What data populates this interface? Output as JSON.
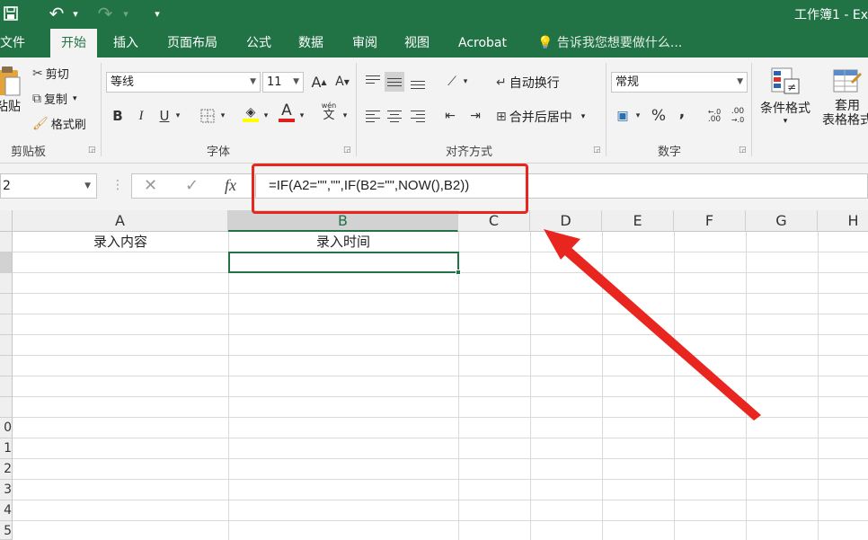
{
  "titlebar": {
    "doc_title": "工作簿1 - Ex",
    "undo_glyph": "↶",
    "redo_glyph": "↷",
    "customize_glyph": "▾"
  },
  "tabs": [
    "文件",
    "开始",
    "插入",
    "页面布局",
    "公式",
    "数据",
    "审阅",
    "视图",
    "Acrobat"
  ],
  "tell_me": "告诉我您想要做什么...",
  "ribbon": {
    "clipboard": {
      "label": "剪贴板",
      "paste": "粘贴",
      "cut": "剪切",
      "copy": "复制",
      "format_painter": "格式刷"
    },
    "font": {
      "label": "字体",
      "name": "等线",
      "size": "11",
      "bold": "B",
      "italic": "I",
      "underline": "U",
      "grow": "A",
      "shrink": "A",
      "font_color": "A",
      "phonetic": "文",
      "phonetic_top": "wén"
    },
    "alignment": {
      "label": "对齐方式",
      "wrap_text": "自动换行",
      "merge_center": "合并后居中"
    },
    "number": {
      "label": "数字",
      "format": "常规",
      "percent": "%",
      "comma": ",",
      "inc_decimal": ".00",
      "dec_decimal": ".00"
    },
    "styles": {
      "conditional": "条件格式",
      "format_table_1": "套用",
      "format_table_2": "表格格式"
    }
  },
  "formula_bar": {
    "name_box": "2",
    "cancel": "✕",
    "enter": "✓",
    "fx": "fx",
    "formula": "=IF(A2=\"\",\"\",IF(B2=\"\",NOW(),B2))"
  },
  "grid": {
    "columns": [
      "A",
      "B",
      "C",
      "D",
      "E",
      "F",
      "G",
      "H"
    ],
    "rows": [
      "",
      "",
      "",
      "",
      "",
      "",
      "",
      "",
      "",
      "0",
      "1",
      "2",
      "3",
      "4",
      "5"
    ],
    "a1": "录入内容",
    "b1": "录入时间"
  },
  "colors": {
    "excel_green": "#217346",
    "annotation_red": "#e8251f"
  }
}
